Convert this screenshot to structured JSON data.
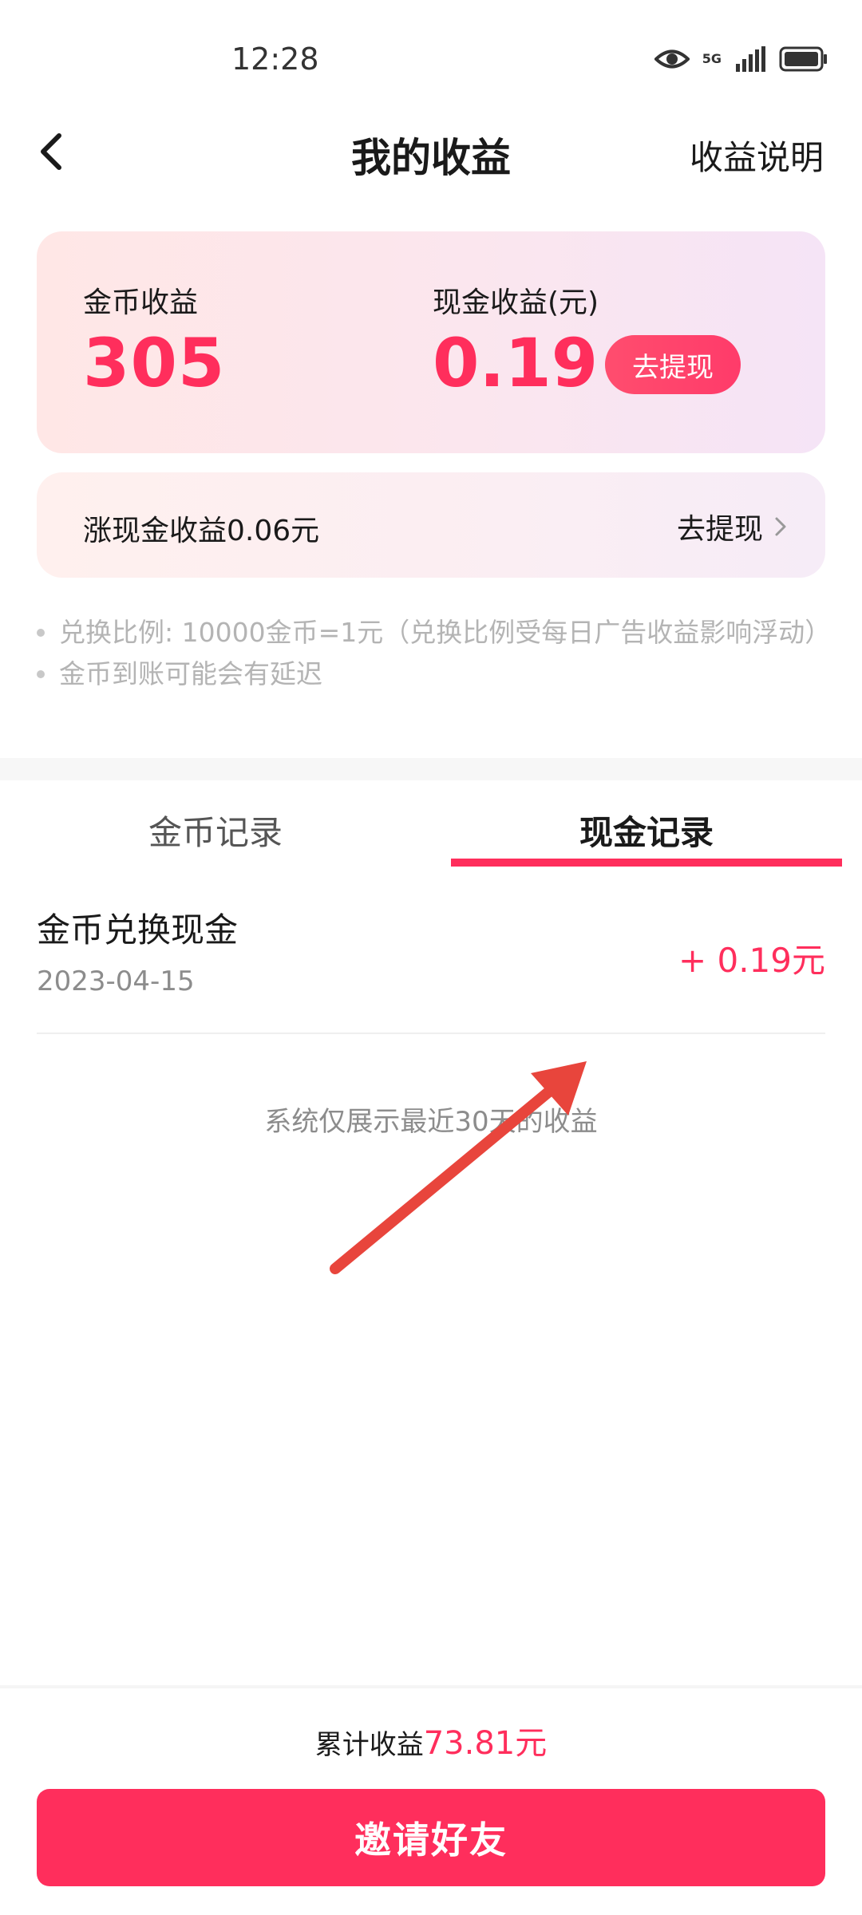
{
  "status_bar": {
    "time": "12:28",
    "network": "5G",
    "icons": [
      "eye-icon",
      "signal-icon",
      "battery-icon"
    ]
  },
  "nav": {
    "title": "我的收益",
    "right_link": "收益说明"
  },
  "earnings": {
    "coin_label": "金币收益",
    "coin_value": "305",
    "cash_label": "现金收益(元)",
    "cash_value": "0.19",
    "withdraw_label": "去提现"
  },
  "banner": {
    "text": "涨现金收益0.06元",
    "link": "去提现"
  },
  "notes": [
    "兑换比例: 10000金币=1元（兑换比例受每日广告收益影响浮动）",
    "金币到账可能会有延迟"
  ],
  "tabs": [
    {
      "label": "金币记录",
      "active": false
    },
    {
      "label": "现金记录",
      "active": true
    }
  ],
  "records": [
    {
      "title": "金币兑换现金",
      "date": "2023-04-15",
      "amount": "+ 0.19元"
    }
  ],
  "recent_note": "系统仅展示最近30天的收益",
  "footer": {
    "total_label": "累计收益",
    "total_value": "73.81元",
    "invite_label": "邀请好友"
  },
  "colors": {
    "accent": "#ff2e5c",
    "annotation": "#e8453c"
  }
}
